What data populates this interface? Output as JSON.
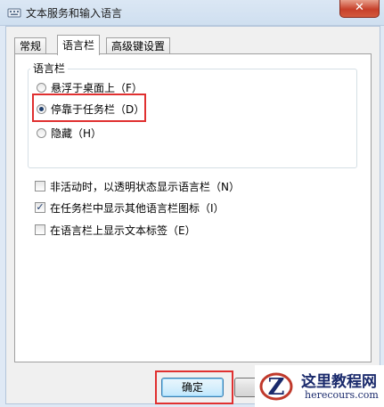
{
  "window": {
    "title": "文本服务和输入语言",
    "close_glyph": "✕"
  },
  "tabs": [
    {
      "label": "常规",
      "active": false
    },
    {
      "label": "语言栏",
      "active": true
    },
    {
      "label": "高级键设置",
      "active": false
    }
  ],
  "language_bar_group": {
    "title": "语言栏",
    "options": [
      {
        "label": "悬浮于桌面上（F）",
        "selected": false
      },
      {
        "label": "停靠于任务栏（D）",
        "selected": true
      },
      {
        "label": "隐藏（H）",
        "selected": false
      }
    ]
  },
  "checkboxes": [
    {
      "label": "非活动时，以透明状态显示语言栏（N）",
      "checked": false
    },
    {
      "label": "在任务栏中显示其他语言栏图标（I）",
      "checked": true
    },
    {
      "label": "在语言栏上显示文本标签（E）",
      "checked": false
    }
  ],
  "buttons": {
    "ok": "确定"
  },
  "watermark": {
    "title": "这里教程网",
    "url": "herecours.com"
  },
  "colors": {
    "highlight_red": "#e03030",
    "title_bar": "#dbe7f4",
    "close_red": "#c7402a"
  },
  "icons": {
    "app": "keyboard-icon",
    "watermark": "z-logo"
  }
}
